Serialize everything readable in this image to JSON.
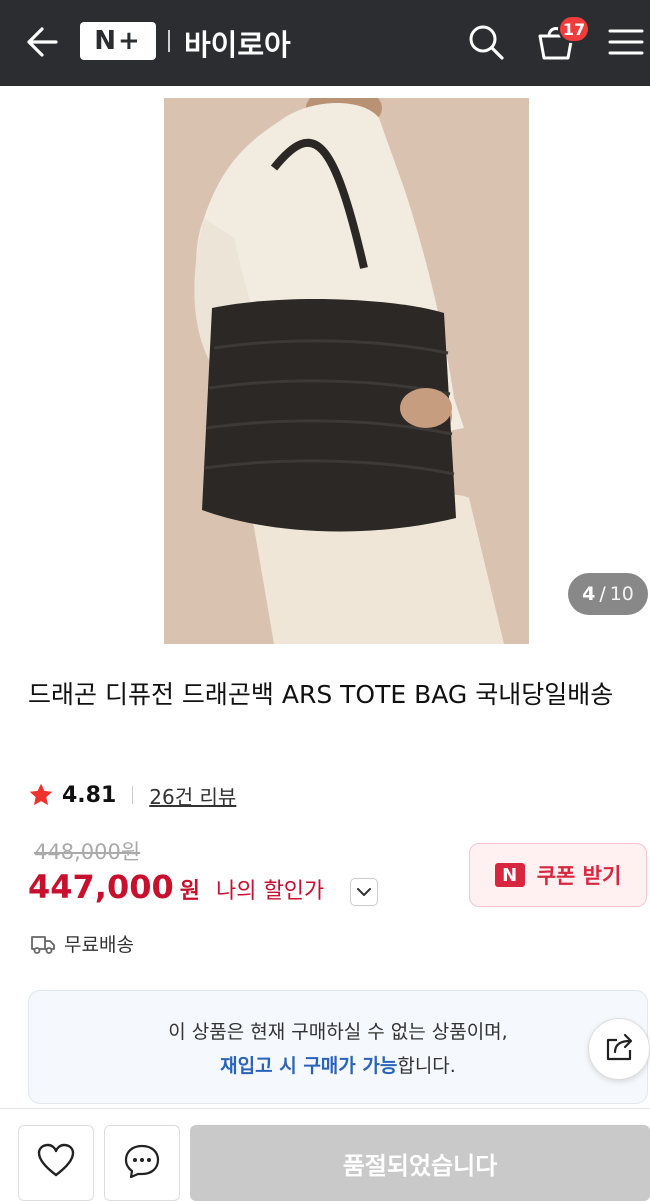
{
  "header": {
    "logo_text": "N+",
    "store_name": "바이로아",
    "cart_count": "17",
    "icons": [
      "back-arrow-icon",
      "search-icon",
      "cart-icon",
      "hamburger-menu-icon"
    ]
  },
  "gallery": {
    "current": "4",
    "separator": "/",
    "total": "10"
  },
  "product": {
    "title": "드래곤 디퓨전 드래곤백 ARS TOTE BAG 국내당일배송",
    "rating": "4.81",
    "reviews_label": "26건 리뷰",
    "original_price": "448,000원",
    "price": "447,000",
    "currency": "원",
    "my_discount_label": "나의 할인가",
    "coupon_logo": "N",
    "coupon_label": "쿠폰 받기",
    "shipping_label": "무료배송"
  },
  "notice": {
    "line1": "이 상품은 현재 구매하실 수 없는 상품이며,",
    "line2_highlight": "재입고 시 구매가 가능",
    "line2_rest": "합니다."
  },
  "bottom": {
    "soldout_label": "품절되었습니다"
  },
  "colors": {
    "header_bg": "#2b2d30",
    "price_red": "#c8102e",
    "notice_blue": "#2a64b8",
    "soldout_gray": "#c9c9c9"
  }
}
